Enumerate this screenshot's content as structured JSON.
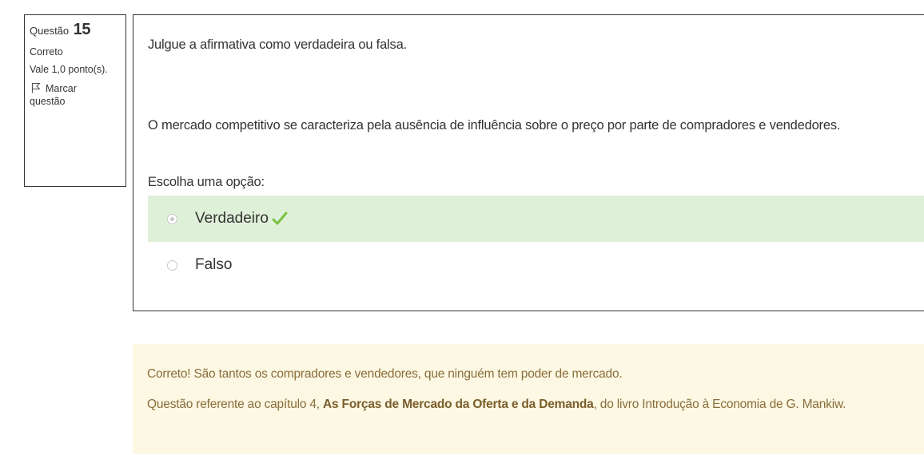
{
  "info": {
    "question_label": "Questão",
    "question_number": "15",
    "state": "Correto",
    "grade": "Vale 1,0 ponto(s).",
    "flag_label_line1": "Marcar",
    "flag_label_line2": "questão"
  },
  "question": {
    "intro": "Julgue a afirmativa como verdadeira ou falsa.",
    "statement": "O mercado competitivo se caracteriza pela ausência de influência sobre o preço por parte de compradores e vendedores.",
    "prompt": "Escolha uma opção:",
    "options": [
      {
        "label": "Verdadeiro",
        "selected": true,
        "correct": true
      },
      {
        "label": "Falso",
        "selected": false,
        "correct": false
      }
    ]
  },
  "feedback": {
    "line1": "Correto! São tantos os compradores e vendedores, que ninguém tem poder de mercado.",
    "line2_prefix": "Questão referente ao capítulo 4, ",
    "line2_bold": "As Forças de Mercado da Oferta e da Demanda",
    "line2_suffix": ", do livro Introdução à Economia de G. Mankiw."
  },
  "colors": {
    "correct_bg": "#dff0d8",
    "feedback_bg": "#fcf8e3",
    "feedback_text": "#8a6d3b",
    "check": "#7ac142"
  },
  "icons": {
    "flag": "flag-icon",
    "check": "check-icon"
  }
}
